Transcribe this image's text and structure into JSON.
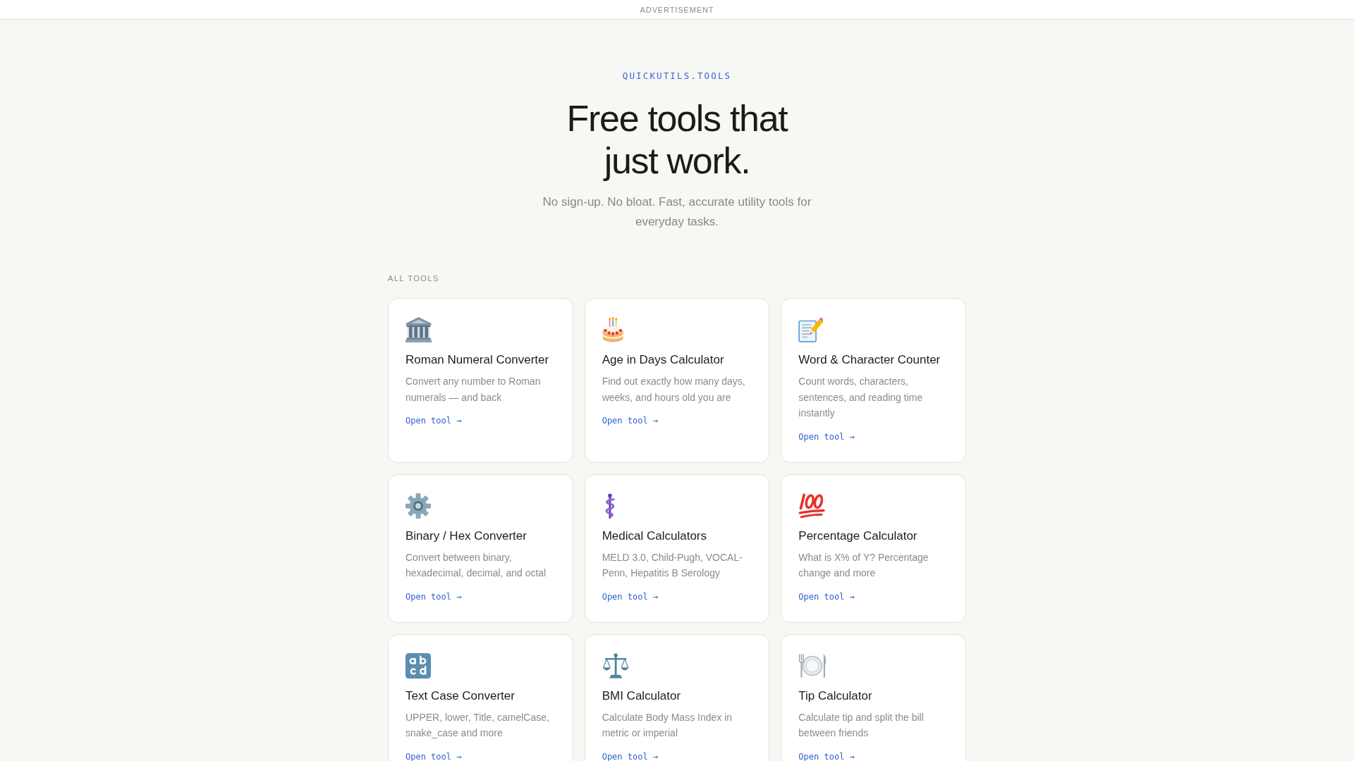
{
  "ad_bar": {
    "label": "ADVERTISEMENT"
  },
  "hero": {
    "brand": "QUICKUTILS.TOOLS",
    "title": "Free tools that just work.",
    "subtitle": "No sign-up. No bloat. Fast, accurate utility tools for everyday tasks."
  },
  "section": {
    "label": "ALL TOOLS"
  },
  "tools": [
    {
      "name": "Roman Numeral Converter",
      "description": "Convert any number to Roman numerals — and back",
      "link": "Open tool →"
    },
    {
      "name": "Age in Days Calculator",
      "description": "Find out exactly how many days, weeks, and hours old you are",
      "link": "Open tool →"
    },
    {
      "name": "Word & Character Counter",
      "description": "Count words, characters, sentences, and reading time instantly",
      "link": "Open tool →"
    },
    {
      "name": "Binary / Hex Converter",
      "description": "Convert between binary, hexadecimal, decimal, and octal",
      "link": "Open tool →"
    },
    {
      "name": "Medical Calculators",
      "description": "MELD 3.0, Child-Pugh, VOCAL-Penn, Hepatitis B Serology",
      "link": "Open tool →"
    },
    {
      "name": "Percentage Calculator",
      "description": "What is X% of Y? Percentage change and more",
      "link": "Open tool →"
    },
    {
      "name": "Text Case Converter",
      "description": "UPPER, lower, Title, camelCase, snake_case and more",
      "link": "Open tool →"
    },
    {
      "name": "BMI Calculator",
      "description": "Calculate Body Mass Index in metric or imperial",
      "link": "Open tool →"
    },
    {
      "name": "Tip Calculator",
      "description": "Calculate tip and split the bill between friends",
      "link": "Open tool →"
    }
  ]
}
